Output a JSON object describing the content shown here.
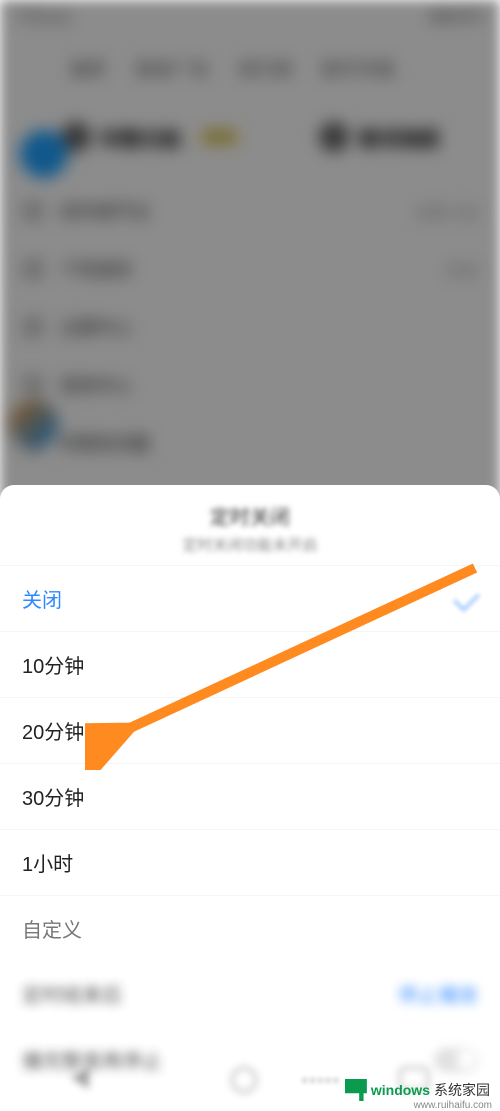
{
  "sheet": {
    "title": "定时关闭",
    "subtitle": "定时关闭功能未开启",
    "options": [
      {
        "label": "关闭",
        "selected": true
      },
      {
        "label": "10分钟",
        "selected": false
      },
      {
        "label": "20分钟",
        "selected": false
      },
      {
        "label": "30分钟",
        "selected": false
      },
      {
        "label": "1小时",
        "selected": false
      },
      {
        "label": "自定义",
        "selected": false
      }
    ],
    "after_row_label": "定时结束后",
    "after_row_value": "停止播放",
    "extra_row_label": "播完整首再停止"
  },
  "bg": {
    "status_left": "下午4:21",
    "status_right": "■ ■ 82%",
    "tabs": [
      "推荐",
      "歌单广场",
      "排行榜",
      "数字专辑"
    ],
    "hero": [
      "听歌识曲",
      "歌词海报"
    ],
    "rows": [
      {
        "label": "创作者平台",
        "right": "立即入驻"
      },
      {
        "label": "个性装扮",
        "right": "红包"
      },
      {
        "label": "主题中心",
        "right": ""
      },
      {
        "label": "音效中心",
        "right": ""
      },
      {
        "label": "听歌免流量",
        "right": ""
      }
    ]
  },
  "watermark": {
    "brand1": "windows",
    "brand2": "系统家园",
    "url": "www.ruihaifu.com"
  }
}
